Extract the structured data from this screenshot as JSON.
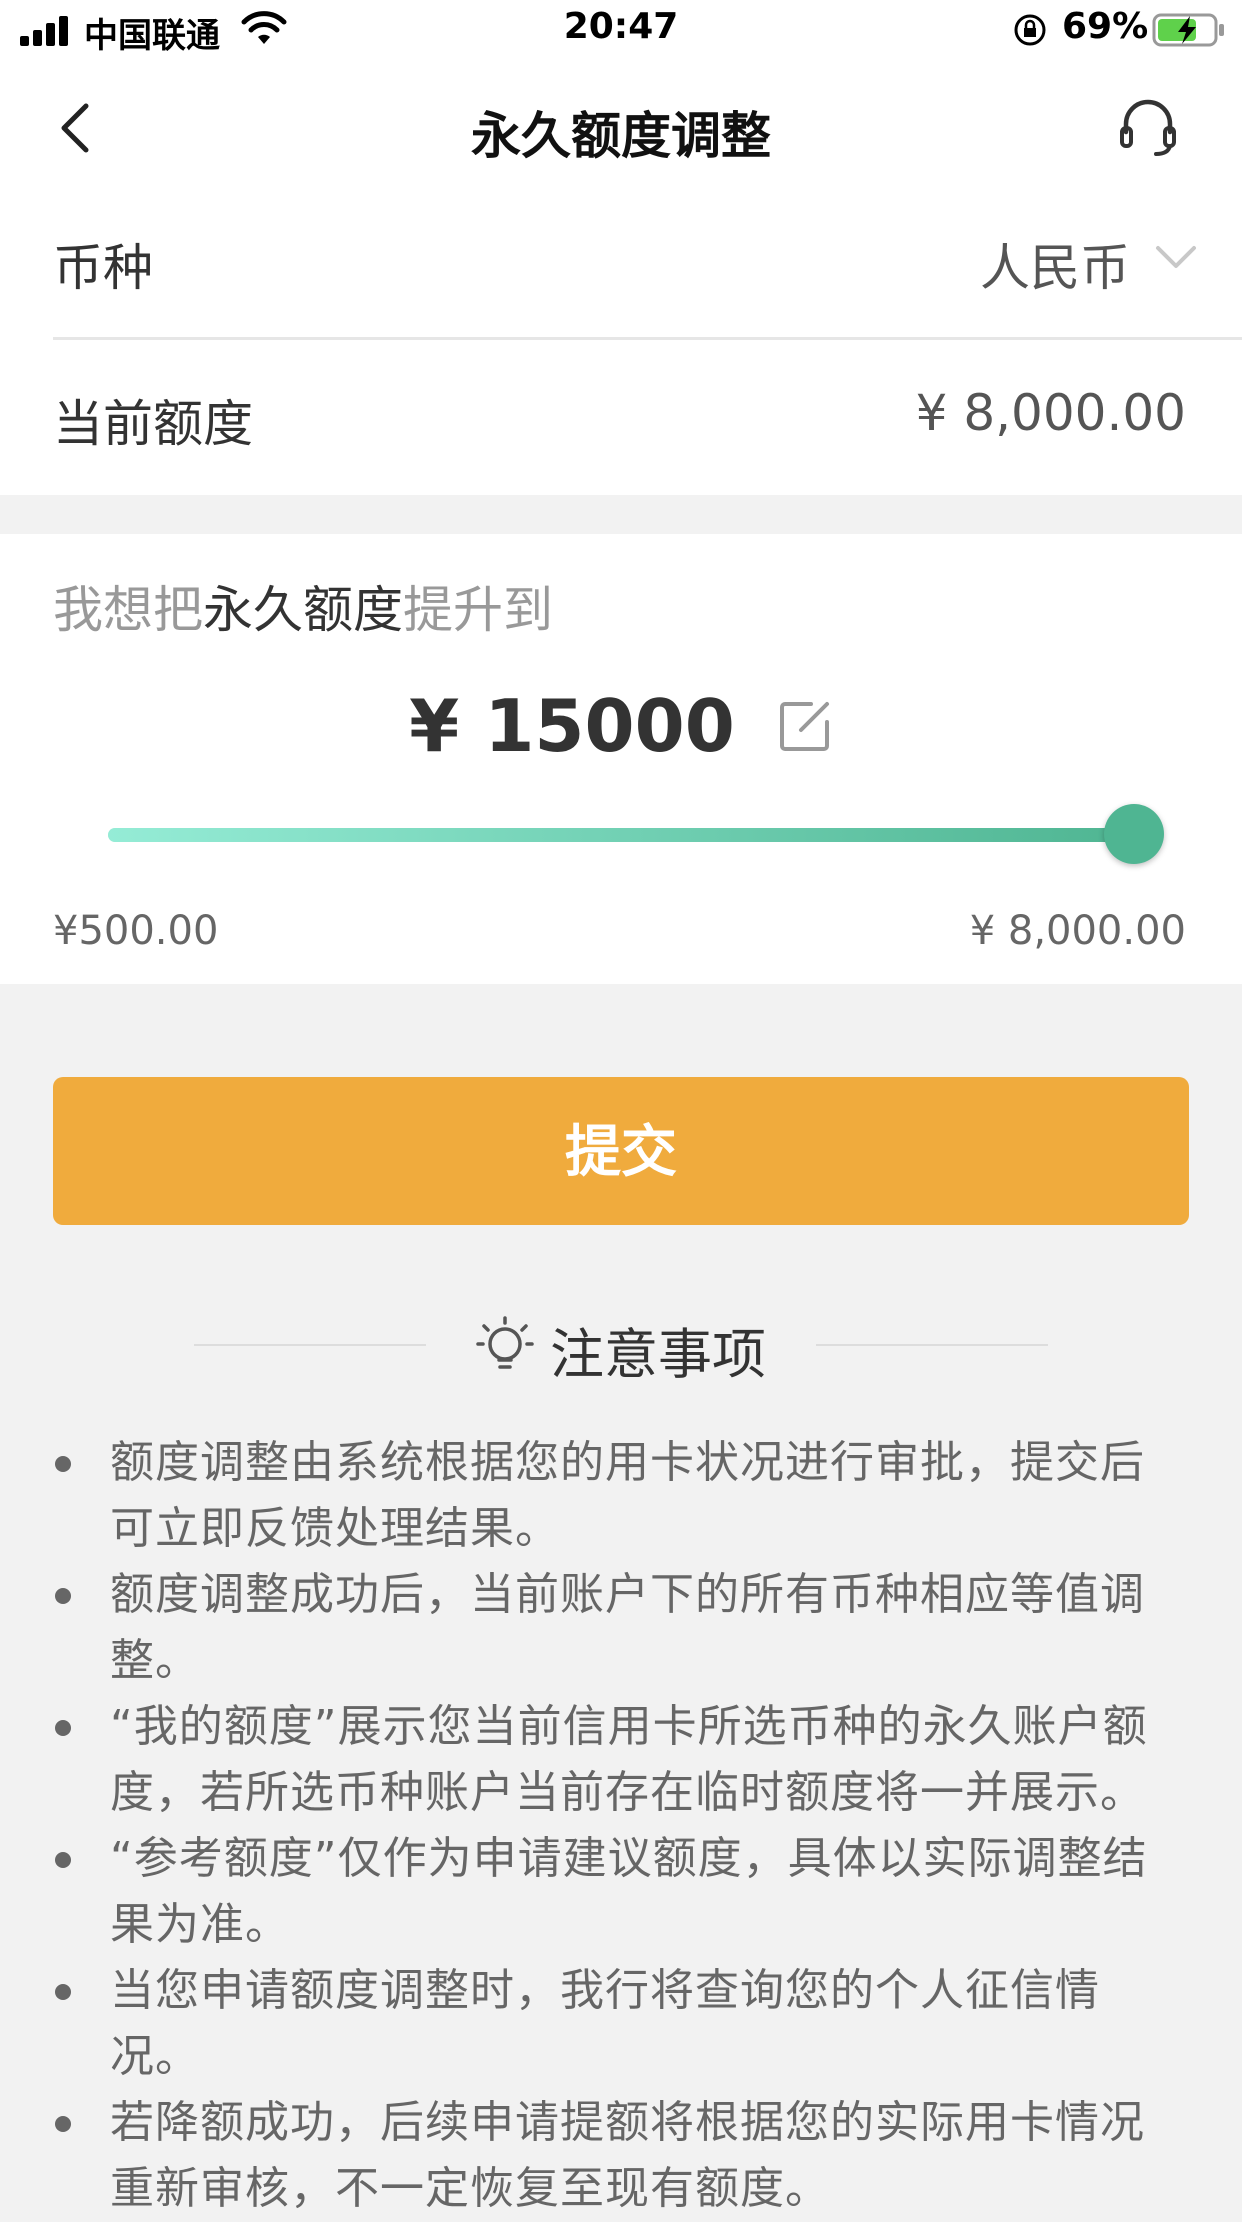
{
  "status_bar": {
    "carrier": "中国联通",
    "time": "20:47",
    "battery_percent": "69%"
  },
  "nav": {
    "title": "永久额度调整"
  },
  "currency_row": {
    "label": "币种",
    "value": "人民币"
  },
  "current_limit_row": {
    "label": "当前额度",
    "value": "¥ 8,000.00"
  },
  "adjust": {
    "prompt_prefix": "我想把",
    "prompt_highlight": "永久额度",
    "prompt_suffix": "提升到",
    "amount": "¥ 15000",
    "slider": {
      "min_label": "¥500.00",
      "max_label": "¥ 8,000.00",
      "fill_fraction": 1.0
    }
  },
  "submit_label": "提交",
  "notes": {
    "title": "注意事项",
    "items": [
      "额度调整由系统根据您的用卡状况进行审批，提交后可立即反馈处理结果。",
      "额度调整成功后，当前账户下的所有币种相应等值调整。",
      "“我的额度”展示您当前信用卡所选币种的永久账户额度，若所选币种账户当前存在临时额度将一并展示。",
      "“参考额度”仅作为申请建议额度，具体以实际调整结果为准。",
      "当您申请额度调整时，我行将查询您的个人征信情况。",
      "若降额成功，后续申请提额将根据您的实际用卡情况重新审核，不一定恢复至现有额度。"
    ]
  },
  "colors": {
    "accent_green": "#4fb592",
    "submit_orange": "#f0ab3d"
  },
  "icons": [
    "signal-icon",
    "wifi-icon",
    "rotation-lock-icon",
    "battery-icon",
    "back-icon",
    "headset-icon",
    "chevron-down-icon",
    "edit-icon",
    "lightbulb-icon"
  ]
}
